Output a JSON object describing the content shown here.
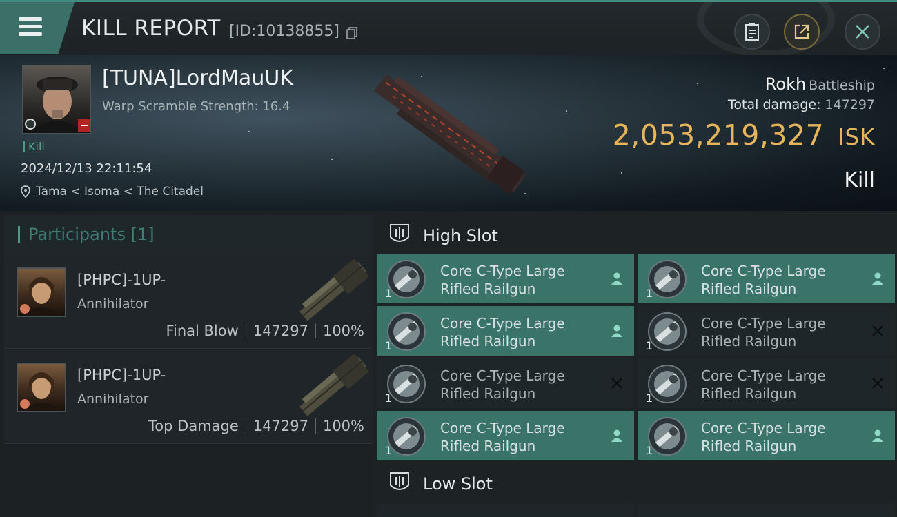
{
  "topbar": {
    "title": "KILL REPORT",
    "report_id": "[ID:10138855]",
    "icons": [
      "menu-icon",
      "copy-icon",
      "clipboard-icon",
      "share-icon",
      "close-icon"
    ]
  },
  "victim": {
    "name": "[TUNA]LordMauUK",
    "warp_scramble": "Warp Scramble Strength: 16.4",
    "kill_tag": "Kill",
    "datetime": "2024/12/13 22:11:54",
    "location": "Tama < Isoma < The Citadel",
    "ship_name": "Rokh",
    "ship_class": "Battleship",
    "total_damage_label": "Total damage:",
    "total_damage": "147297",
    "isk_value": "2,053,219,327",
    "isk_unit": "ISK",
    "result": "Kill"
  },
  "participants": {
    "header": "Participants [1]",
    "rows": [
      {
        "name": "[PHPC]-1UP-",
        "ship": "Annihilator",
        "role": "Final Blow",
        "damage": "147297",
        "percent": "100%"
      },
      {
        "name": "[PHPC]-1UP-",
        "ship": "Annihilator",
        "role": "Top Damage",
        "damage": "147297",
        "percent": "100%"
      }
    ]
  },
  "slots": {
    "high_label": "High Slot",
    "low_label": "Low Slot",
    "modules": [
      {
        "line1": "Core C-Type Large",
        "line2": "Rifled Railgun",
        "qty": "1",
        "state": "dropped"
      },
      {
        "line1": "Core C-Type Large",
        "line2": "Rifled Railgun",
        "qty": "1",
        "state": "dropped"
      },
      {
        "line1": "Core C-Type Large",
        "line2": "Rifled Railgun",
        "qty": "1",
        "state": "dropped"
      },
      {
        "line1": "Core C-Type Large",
        "line2": "Rifled Railgun",
        "qty": "1",
        "state": "destroyed"
      },
      {
        "line1": "Core C-Type Large",
        "line2": "Rifled Railgun",
        "qty": "1",
        "state": "destroyed"
      },
      {
        "line1": "Core C-Type Large",
        "line2": "Rifled Railgun",
        "qty": "1",
        "state": "destroyed"
      },
      {
        "line1": "Core C-Type Large",
        "line2": "Rifled Railgun",
        "qty": "1",
        "state": "dropped"
      },
      {
        "line1": "Core C-Type Large",
        "line2": "Rifled Railgun",
        "qty": "1",
        "state": "dropped"
      }
    ]
  },
  "colors": {
    "accent_teal": "#3a7469",
    "isk_gold": "#e6b45b",
    "background": "#1b1f22"
  }
}
